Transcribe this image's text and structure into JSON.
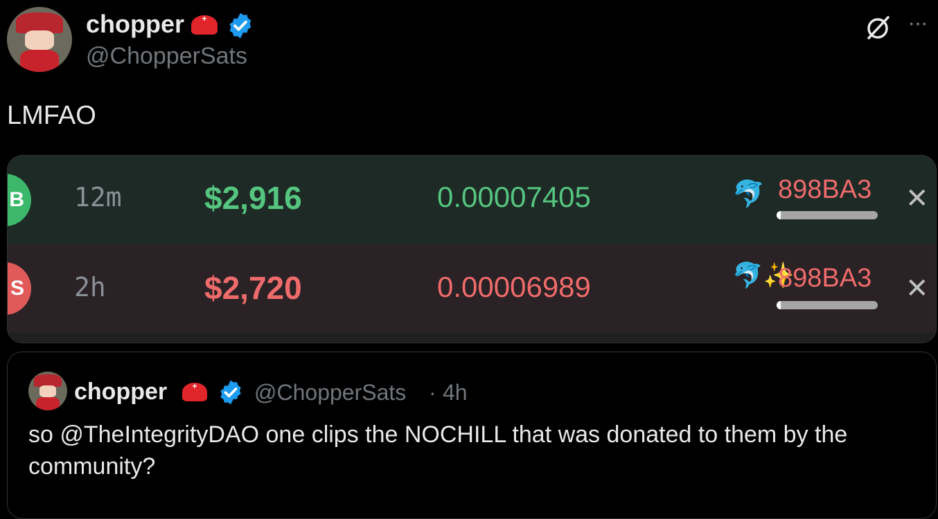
{
  "tweet": {
    "author_name": "chopper",
    "author_handle": "@ChopperSats",
    "text": "LMFAO",
    "more_icon": "ellipsis-icon",
    "grok_icon": "grok-icon"
  },
  "trades": [
    {
      "badge": "B",
      "age": "12m",
      "amount": "$2,916",
      "price": "0.00007405",
      "emoji": "🐬",
      "address": "898BA3",
      "side_color": "#3bb86a",
      "amount_color": "#55c57f",
      "price_color": "#55c57f",
      "holding_fraction": 0.04
    },
    {
      "badge": "S",
      "age": "2h",
      "amount": "$2,720",
      "price": "0.00006989",
      "emoji": "🐬✨",
      "address": "898BA3",
      "side_color": "#e05a5a",
      "amount_color": "#ef6b6b",
      "price_color": "#ef6b6b",
      "holding_fraction": 0.04
    }
  ],
  "quoted": {
    "author_name": "chopper",
    "author_handle": "@ChopperSats",
    "separator": "·",
    "time": "4h",
    "text_line1": "so @TheIntegrityDAO one clips the NOCHILL that was donated to them by the",
    "text_line2": "community?"
  },
  "colors": {
    "verified": "#1d9bf0",
    "address": "#ef6b6b",
    "age": "#8a9096"
  }
}
